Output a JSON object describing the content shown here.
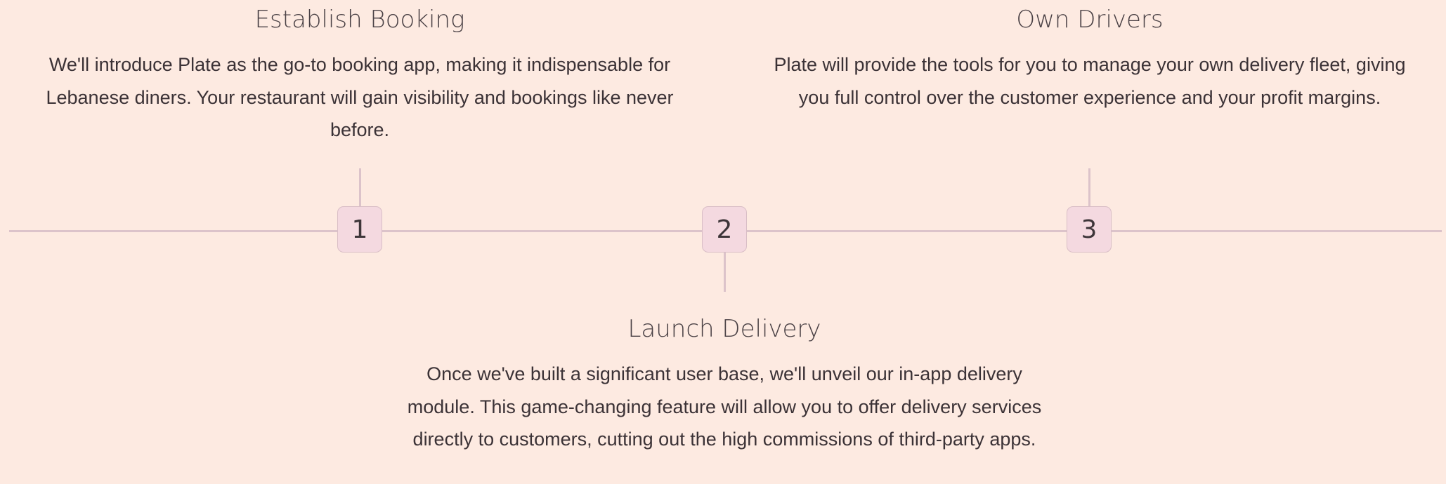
{
  "steps": [
    {
      "number": "1",
      "title": "Establish Booking",
      "description": "We'll introduce Plate as the go-to booking app, making it indispensable for Lebanese diners. Your restaurant will gain visibility and bookings like never before."
    },
    {
      "number": "2",
      "title": "Launch Delivery",
      "description": "Once we've built a significant user base, we'll unveil our in-app delivery module. This game-changing feature will allow you to offer delivery services directly to customers, cutting out the high commissions of third-party apps."
    },
    {
      "number": "3",
      "title": "Own Drivers",
      "description": "Plate will provide the tools for you to manage your own delivery fleet, giving you full control over the customer experience and your profit margins."
    }
  ],
  "colors": {
    "background": "#fdeae1",
    "timeline_line": "#dcc3ca",
    "marker_fill": "#f4d9e0",
    "text": "#3b3236"
  }
}
